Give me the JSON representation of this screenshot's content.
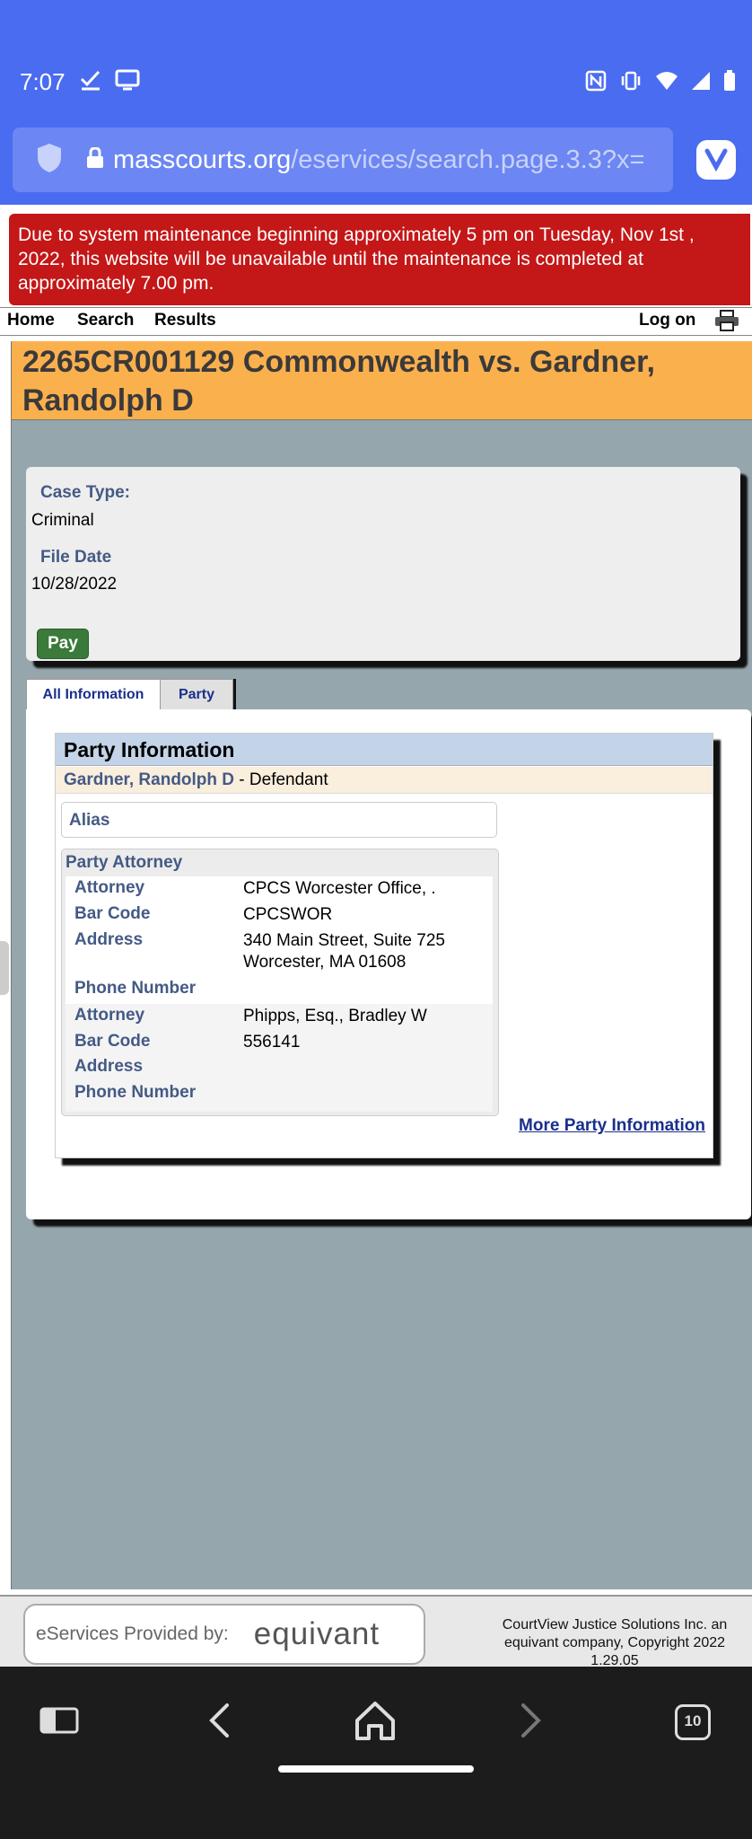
{
  "status_bar": {
    "time": "7:07"
  },
  "url_bar": {
    "domain": "masscourts.org",
    "path": "/eservices/search.page.3.3?x="
  },
  "alert": {
    "text": "Due to system maintenance beginning approximately 5 pm on Tuesday, Nov 1st , 2022, this website will be unavailable until the maintenance is completed at approximately 7.00 pm."
  },
  "nav": {
    "home": "Home",
    "search": "Search",
    "results": "Results",
    "log_on": "Log on"
  },
  "case": {
    "title": "2265CR001129 Commonwealth vs. Gardner, Randolph D",
    "case_type_label": "Case Type:",
    "case_type_value": "Criminal",
    "file_date_label": "File Date",
    "file_date_value": "10/28/2022",
    "pay_label": "Pay"
  },
  "tabs": {
    "all_information": "All Information",
    "party": "Party"
  },
  "party_info": {
    "header": "Party Information",
    "party_name": "Gardner, Randolph D",
    "party_role": " - Defendant",
    "alias_label": "Alias",
    "attorney_section_title": "Party Attorney",
    "attorneys": [
      {
        "attorney_label": "Attorney",
        "attorney_value": "CPCS Worcester Office, .",
        "bar_code_label": "Bar Code",
        "bar_code_value": "CPCSWOR",
        "address_label": "Address",
        "address_line1": "340 Main Street, Suite 725",
        "address_line2": "Worcester, MA  01608",
        "phone_label": "Phone Number"
      },
      {
        "attorney_label": "Attorney",
        "attorney_value": "Phipps, Esq., Bradley W",
        "bar_code_label": "Bar Code",
        "bar_code_value": "556141",
        "address_label": "Address",
        "phone_label": "Phone Number"
      }
    ],
    "more_link": "More Party Information"
  },
  "footer": {
    "provided_by": "eServices Provided by:",
    "logo_text": "equivant",
    "copyright_line1": "CourtView Justice Solutions Inc. an equivant company, Copyright 2022",
    "version": "1.29.05"
  },
  "bottom_nav": {
    "tab_count": "10"
  }
}
